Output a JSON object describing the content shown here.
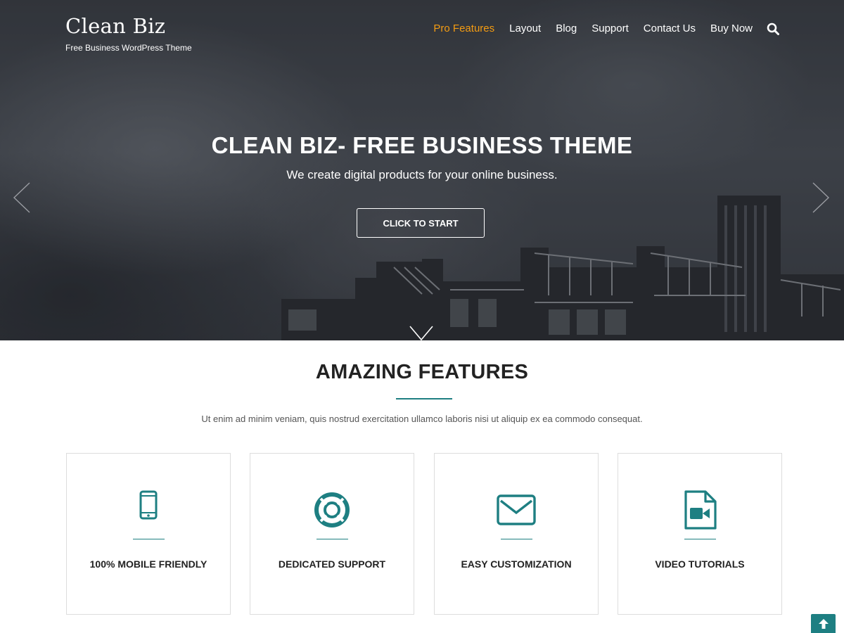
{
  "header": {
    "brand_title": "Clean Biz",
    "brand_tagline": "Free Business WordPress Theme",
    "nav": [
      "Pro Features",
      "Layout",
      "Blog",
      "Support",
      "Contact Us",
      "Buy Now"
    ],
    "active_nav": "Pro Features",
    "search_icon": "search-icon"
  },
  "hero": {
    "title": "CLEAN BIZ- FREE BUSINESS THEME",
    "subtitle": "We create digital products for your online business.",
    "cta_label": "CLICK TO START"
  },
  "features": {
    "title": "AMAZING FEATURES",
    "description": "Ut enim ad minim veniam, quis nostrud exercitation ullamco laboris nisi ut aliquip ex ea commodo consequat.",
    "items": [
      {
        "icon": "mobile-phone-icon",
        "label": "100% MOBILE FRIENDLY"
      },
      {
        "icon": "life-ring-icon",
        "label": "DEDICATED SUPPORT"
      },
      {
        "icon": "envelope-icon",
        "label": "EASY CUSTOMIZATION"
      },
      {
        "icon": "video-file-icon",
        "label": "VIDEO TUTORIALS"
      }
    ]
  },
  "colors": {
    "accent_teal": "#1e7f82",
    "nav_active": "#f39c12"
  }
}
